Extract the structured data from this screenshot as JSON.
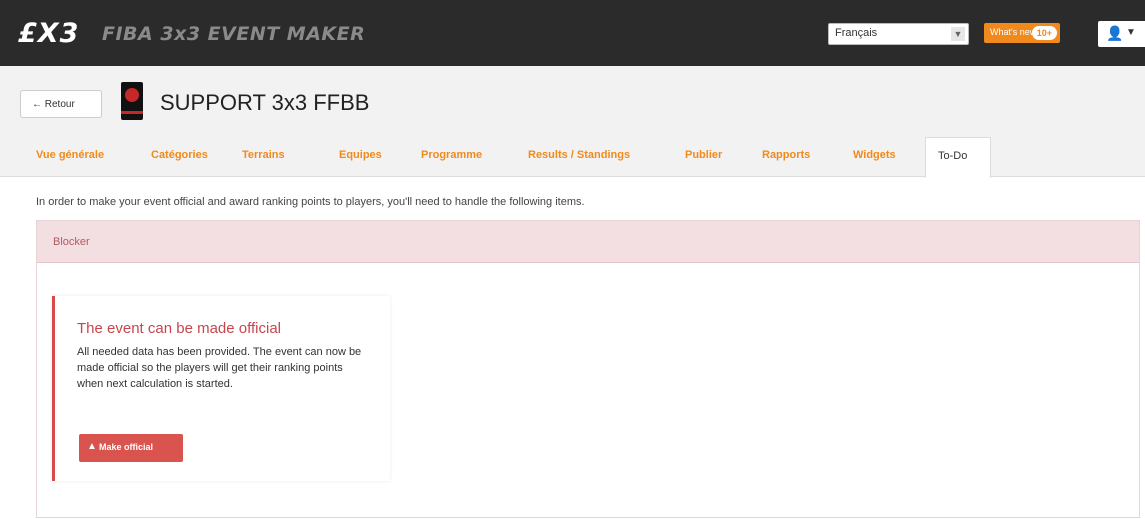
{
  "app": {
    "logo_text": "£X3",
    "title": "FIBA 3x3 EVENT MAKER"
  },
  "topbar": {
    "language": "Français",
    "whats_new_label": "What's new",
    "whats_new_count": "10+",
    "user_icon": "user-icon"
  },
  "header": {
    "back_label": "← Retour",
    "event_title": "SUPPORT 3x3 FFBB"
  },
  "tabs": [
    {
      "label": "Vue générale"
    },
    {
      "label": "Catégories"
    },
    {
      "label": "Terrains"
    },
    {
      "label": "Equipes"
    },
    {
      "label": "Programme"
    },
    {
      "label": "Results / Standings"
    },
    {
      "label": "Publier"
    },
    {
      "label": "Rapports"
    },
    {
      "label": "Widgets"
    },
    {
      "label": "To-Do",
      "active": true
    }
  ],
  "content": {
    "intro": "In order to make your event official and award ranking points to players, you'll need to handle the following items.",
    "panel_title": "Blocker",
    "card": {
      "title": "The event can be made official",
      "text": "All needed data has been provided. The event can now be made official so the players will get their ranking points when next calculation is started.",
      "button_label": "Make official"
    }
  },
  "colors": {
    "accent": "#f08a1d",
    "topbar": "#2b2b2b",
    "danger": "#d9534f",
    "blocker_bg": "#f3dfe1"
  }
}
